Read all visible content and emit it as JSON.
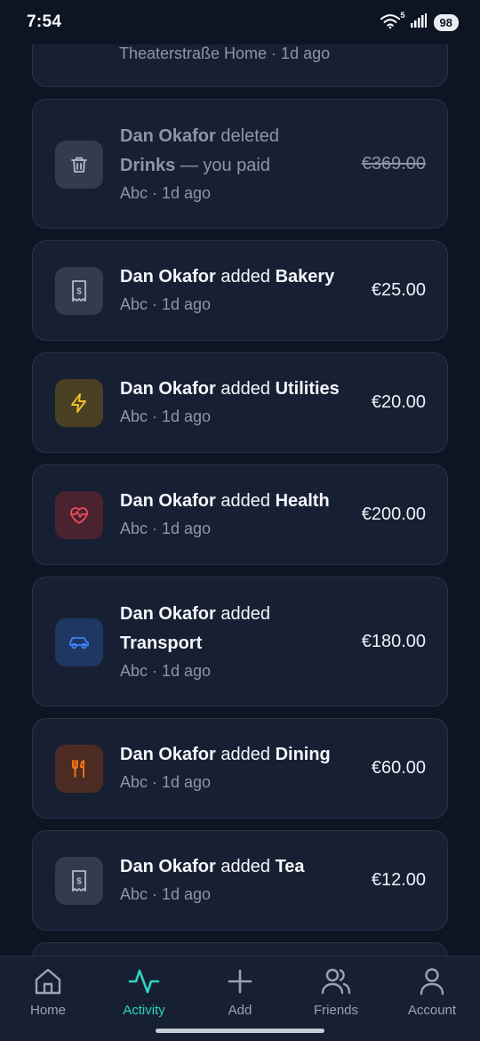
{
  "status_bar": {
    "time": "7:54",
    "battery": "98",
    "wifi_label": "5"
  },
  "top_card": {
    "subtitle": "Theaterstraße Home · 1d ago"
  },
  "activities": [
    {
      "actor": "Dan Okafor",
      "action": "deleted",
      "item": "Drinks",
      "suffix": "— you paid",
      "meta": "Abc · 1d ago",
      "amount": "€369.00",
      "icon": "trash-icon",
      "accent": "#3a4356",
      "deleted": true
    },
    {
      "actor": "Dan Okafor",
      "action": "added",
      "item": "Bakery",
      "suffix": "",
      "meta": "Abc · 1d ago",
      "amount": "€25.00",
      "icon": "receipt-icon",
      "accent": "#3a4356",
      "deleted": false
    },
    {
      "actor": "Dan Okafor",
      "action": "added",
      "item": "Utilities",
      "suffix": "",
      "meta": "Abc · 1d ago",
      "amount": "€20.00",
      "icon": "lightning-icon",
      "accent": "#4a4124",
      "deleted": false
    },
    {
      "actor": "Dan Okafor",
      "action": "added",
      "item": "Health",
      "suffix": "",
      "meta": "Abc · 1d ago",
      "amount": "€200.00",
      "icon": "heart-pulse-icon",
      "accent": "#4a2230",
      "deleted": false
    },
    {
      "actor": "Dan Okafor",
      "action": "added",
      "item": "Transport",
      "suffix": "",
      "meta": "Abc · 1d ago",
      "amount": "€180.00",
      "icon": "car-icon",
      "accent": "#1f3763",
      "deleted": false
    },
    {
      "actor": "Dan Okafor",
      "action": "added",
      "item": "Dining",
      "suffix": "",
      "meta": "Abc · 1d ago",
      "amount": "€60.00",
      "icon": "utensils-icon",
      "accent": "#4c2c22",
      "deleted": false
    },
    {
      "actor": "Dan Okafor",
      "action": "added",
      "item": "Tea",
      "suffix": "",
      "meta": "Abc · 1d ago",
      "amount": "€12.00",
      "icon": "receipt-icon",
      "accent": "#3a4356",
      "deleted": false
    }
  ],
  "nav": [
    {
      "label": "Home",
      "icon": "home-icon",
      "active": false
    },
    {
      "label": "Activity",
      "icon": "activity-icon",
      "active": true
    },
    {
      "label": "Add",
      "icon": "plus-icon",
      "active": false
    },
    {
      "label": "Friends",
      "icon": "friends-icon",
      "active": false
    },
    {
      "label": "Account",
      "icon": "account-icon",
      "active": false
    }
  ],
  "colors": {
    "background": "#0d1422",
    "card": "#172033",
    "accent_active": "#2dd4bf",
    "muted_text": "#8c96a8"
  }
}
